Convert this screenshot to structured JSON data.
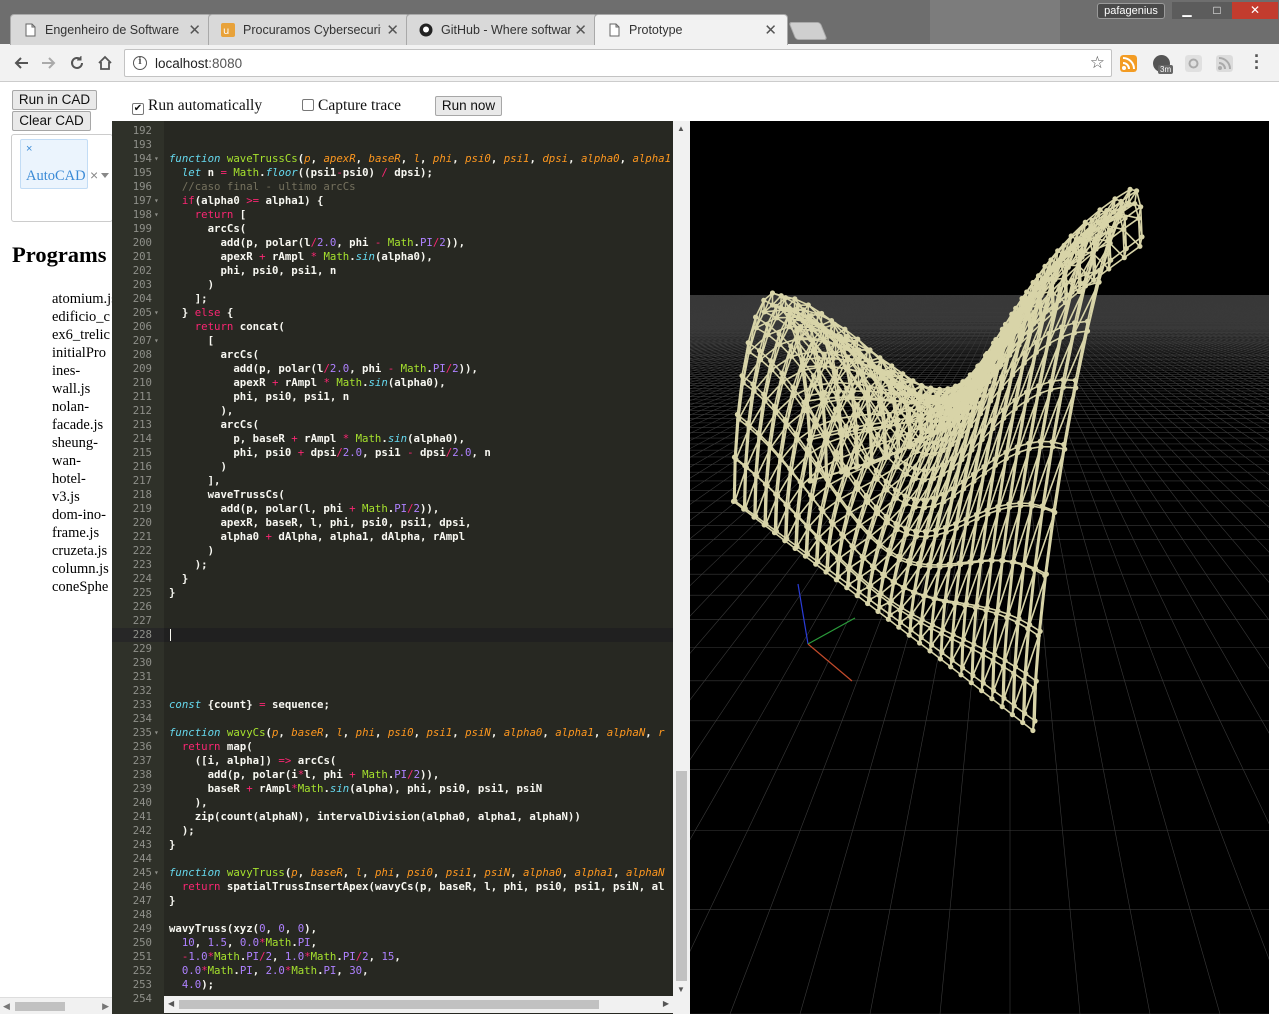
{
  "browser": {
    "tabs": [
      {
        "label": "Engenheiro de Software",
        "icon": "document-icon"
      },
      {
        "label": "Procuramos Cybersecurity",
        "icon": "nu-icon"
      },
      {
        "label": "GitHub - Where software",
        "icon": "github-icon"
      },
      {
        "label": "Prototype",
        "icon": "document-icon",
        "active": true
      }
    ],
    "tab_close": "✕",
    "profile": "pafagenius",
    "window_buttons": {
      "minimize": "▁",
      "maximize": "□",
      "close": "✕"
    },
    "url_host": "localhost",
    "url_port": ":8080",
    "extension_badge": "3m"
  },
  "controls": {
    "run_in_cad": "Run in CAD",
    "clear_cad": "Clear CAD",
    "run_automatically": "Run automatically",
    "run_automatically_checked": true,
    "capture_trace": "Capture trace",
    "capture_trace_checked": false,
    "run_now": "Run now"
  },
  "cad_select": {
    "chip_close": "×",
    "selected": "AutoCAD",
    "clear": "×"
  },
  "programs": {
    "title": "Programs",
    "items": [
      "atomium.js",
      "edificio_c",
      "ex6_trelic",
      "initialPro",
      "ines-\nwall.js",
      "nolan-\nfacade.js",
      "sheung-\nwan-\nhotel-\nv3.js",
      "dom-ino-\nframe.js",
      "cruzeta.js",
      "column.js",
      "coneSphe"
    ]
  },
  "editor": {
    "lines": [
      {
        "n": 192,
        "code": ""
      },
      {
        "n": 193,
        "code": ""
      },
      {
        "n": 194,
        "fold": true,
        "code": "<span class=\"f\">function</span> <span class=\"m\">waveTrussCs</span>(<span class=\"p\">p</span>, <span class=\"p\">apexR</span>, <span class=\"p\">baseR</span>, <span class=\"p\">l</span>, <span class=\"p\">phi</span>, <span class=\"p\">psi0</span>, <span class=\"p\">psi1</span>, <span class=\"p\">dpsi</span>, <span class=\"p\">alpha0</span>, <span class=\"p\">alpha1</span>"
      },
      {
        "n": 195,
        "code": "  <span class=\"f\">let</span> n <span class=\"k\">=</span> <span class=\"m\">Math</span>.<span class=\"f\">floor</span>((psi1<span class=\"k\">-</span>psi0) <span class=\"k\">/</span> dpsi);"
      },
      {
        "n": 196,
        "code": "  <span class=\"c\">//caso final - ultimo arcCs</span>"
      },
      {
        "n": 197,
        "fold": true,
        "code": "  <span class=\"k\">if</span>(alpha0 <span class=\"k\">&gt;=</span> alpha1) {"
      },
      {
        "n": 198,
        "fold": true,
        "code": "    <span class=\"k\">return</span> ["
      },
      {
        "n": 199,
        "code": "      arcCs("
      },
      {
        "n": 200,
        "code": "        add(p, polar(l<span class=\"k\">/</span><span class=\"n\">2.0</span>, phi <span class=\"k\">-</span> <span class=\"m\">Math</span>.<span class=\"n\">PI</span><span class=\"k\">/</span><span class=\"n\">2</span>)),"
      },
      {
        "n": 201,
        "code": "        apexR <span class=\"k\">+</span> rAmpl <span class=\"k\">*</span> <span class=\"m\">Math</span>.<span class=\"f\">sin</span>(alpha0),"
      },
      {
        "n": 202,
        "code": "        phi, psi0, psi1, n"
      },
      {
        "n": 203,
        "code": "      )"
      },
      {
        "n": 204,
        "code": "    ];"
      },
      {
        "n": 205,
        "fold": true,
        "code": "  } <span class=\"k\">else</span> {"
      },
      {
        "n": 206,
        "code": "    <span class=\"k\">return</span> concat("
      },
      {
        "n": 207,
        "fold": true,
        "code": "      ["
      },
      {
        "n": 208,
        "code": "        arcCs("
      },
      {
        "n": 209,
        "code": "          add(p, polar(l<span class=\"k\">/</span><span class=\"n\">2.0</span>, phi <span class=\"k\">-</span> <span class=\"m\">Math</span>.<span class=\"n\">PI</span><span class=\"k\">/</span><span class=\"n\">2</span>)),"
      },
      {
        "n": 210,
        "code": "          apexR <span class=\"k\">+</span> rAmpl <span class=\"k\">*</span> <span class=\"m\">Math</span>.<span class=\"f\">sin</span>(alpha0),"
      },
      {
        "n": 211,
        "code": "          phi, psi0, psi1, n"
      },
      {
        "n": 212,
        "code": "        ),"
      },
      {
        "n": 213,
        "code": "        arcCs("
      },
      {
        "n": 214,
        "code": "          p, baseR <span class=\"k\">+</span> rAmpl <span class=\"k\">*</span> <span class=\"m\">Math</span>.<span class=\"f\">sin</span>(alpha0),"
      },
      {
        "n": 215,
        "code": "          phi, psi0 <span class=\"k\">+</span> dpsi<span class=\"k\">/</span><span class=\"n\">2.0</span>, psi1 <span class=\"k\">-</span> dpsi<span class=\"k\">/</span><span class=\"n\">2.0</span>, n"
      },
      {
        "n": 216,
        "code": "        )"
      },
      {
        "n": 217,
        "code": "      ],"
      },
      {
        "n": 218,
        "code": "      waveTrussCs("
      },
      {
        "n": 219,
        "code": "        add(p, polar(l, phi <span class=\"k\">+</span> <span class=\"m\">Math</span>.<span class=\"n\">PI</span><span class=\"k\">/</span><span class=\"n\">2</span>)),"
      },
      {
        "n": 220,
        "code": "        apexR, baseR, l, phi, psi0, psi1, dpsi,"
      },
      {
        "n": 221,
        "code": "        alpha0 <span class=\"k\">+</span> dAlpha, alpha1, dAlpha, rAmpl"
      },
      {
        "n": 222,
        "code": "      )"
      },
      {
        "n": 223,
        "code": "    );"
      },
      {
        "n": 224,
        "code": "  }"
      },
      {
        "n": 225,
        "code": "}"
      },
      {
        "n": 226,
        "code": ""
      },
      {
        "n": 227,
        "code": ""
      },
      {
        "n": 228,
        "code": "",
        "active": true
      },
      {
        "n": 229,
        "code": ""
      },
      {
        "n": 230,
        "code": ""
      },
      {
        "n": 231,
        "code": ""
      },
      {
        "n": 232,
        "code": ""
      },
      {
        "n": 233,
        "code": "<span class=\"f\">const</span> {count} <span class=\"k\">=</span> sequence;"
      },
      {
        "n": 234,
        "code": ""
      },
      {
        "n": 235,
        "fold": true,
        "code": "<span class=\"f\">function</span> <span class=\"m\">wavyCs</span>(<span class=\"p\">p</span>, <span class=\"p\">baseR</span>, <span class=\"p\">l</span>, <span class=\"p\">phi</span>, <span class=\"p\">psi0</span>, <span class=\"p\">psi1</span>, <span class=\"p\">psiN</span>, <span class=\"p\">alpha0</span>, <span class=\"p\">alpha1</span>, <span class=\"p\">alphaN</span>, <span class=\"p\">r</span>"
      },
      {
        "n": 236,
        "code": "  <span class=\"k\">return</span> map("
      },
      {
        "n": 237,
        "code": "    ([i, alpha]) <span class=\"k\">=&gt;</span> arcCs("
      },
      {
        "n": 238,
        "code": "      add(p, polar(i<span class=\"k\">*</span>l, phi <span class=\"k\">+</span> <span class=\"m\">Math</span>.<span class=\"n\">PI</span><span class=\"k\">/</span><span class=\"n\">2</span>)),"
      },
      {
        "n": 239,
        "code": "      baseR <span class=\"k\">+</span> rAmpl<span class=\"k\">*</span><span class=\"m\">Math</span>.<span class=\"f\">sin</span>(alpha), phi, psi0, psi1, psiN"
      },
      {
        "n": 240,
        "code": "    ),"
      },
      {
        "n": 241,
        "code": "    zip(count(alphaN), intervalDivision(alpha0, alpha1, alphaN))"
      },
      {
        "n": 242,
        "code": "  );"
      },
      {
        "n": 243,
        "code": "}"
      },
      {
        "n": 244,
        "code": ""
      },
      {
        "n": 245,
        "fold": true,
        "code": "<span class=\"f\">function</span> <span class=\"m\">wavyTruss</span>(<span class=\"p\">p</span>, <span class=\"p\">baseR</span>, <span class=\"p\">l</span>, <span class=\"p\">phi</span>, <span class=\"p\">psi0</span>, <span class=\"p\">psi1</span>, <span class=\"p\">psiN</span>, <span class=\"p\">alpha0</span>, <span class=\"p\">alpha1</span>, <span class=\"p\">alphaN</span>"
      },
      {
        "n": 246,
        "code": "  <span class=\"k\">return</span> spatialTrussInsertApex(wavyCs(p, baseR, l, phi, psi0, psi1, psiN, al"
      },
      {
        "n": 247,
        "code": "}"
      },
      {
        "n": 248,
        "code": ""
      },
      {
        "n": 249,
        "code": "wavyTruss(xyz(<span class=\"n\">0</span>, <span class=\"n\">0</span>, <span class=\"n\">0</span>),"
      },
      {
        "n": 250,
        "code": "  <span class=\"n\">10</span>, <span class=\"n\">1.5</span>, <span class=\"n\">0.0</span><span class=\"k\">*</span><span class=\"m\">Math</span>.<span class=\"n\">PI</span>,"
      },
      {
        "n": 251,
        "code": "  <span class=\"k\">-</span><span class=\"n\">1.0</span><span class=\"k\">*</span><span class=\"m\">Math</span>.<span class=\"n\">PI</span><span class=\"k\">/</span><span class=\"n\">2</span>, <span class=\"n\">1.0</span><span class=\"k\">*</span><span class=\"m\">Math</span>.<span class=\"n\">PI</span><span class=\"k\">/</span><span class=\"n\">2</span>, <span class=\"n\">15</span>,"
      },
      {
        "n": 252,
        "code": "  <span class=\"n\">0.0</span><span class=\"k\">*</span><span class=\"m\">Math</span>.<span class=\"n\">PI</span>, <span class=\"n\">2.0</span><span class=\"k\">*</span><span class=\"m\">Math</span>.<span class=\"n\">PI</span>, <span class=\"n\">30</span>,"
      },
      {
        "n": 253,
        "code": "  <span class=\"n\">4.0</span>);"
      },
      {
        "n": 254,
        "code": ""
      }
    ]
  },
  "viewport": {
    "background": "#000000",
    "grid_color": "#3a3a3a",
    "truss_color": "#d8d4a8"
  }
}
